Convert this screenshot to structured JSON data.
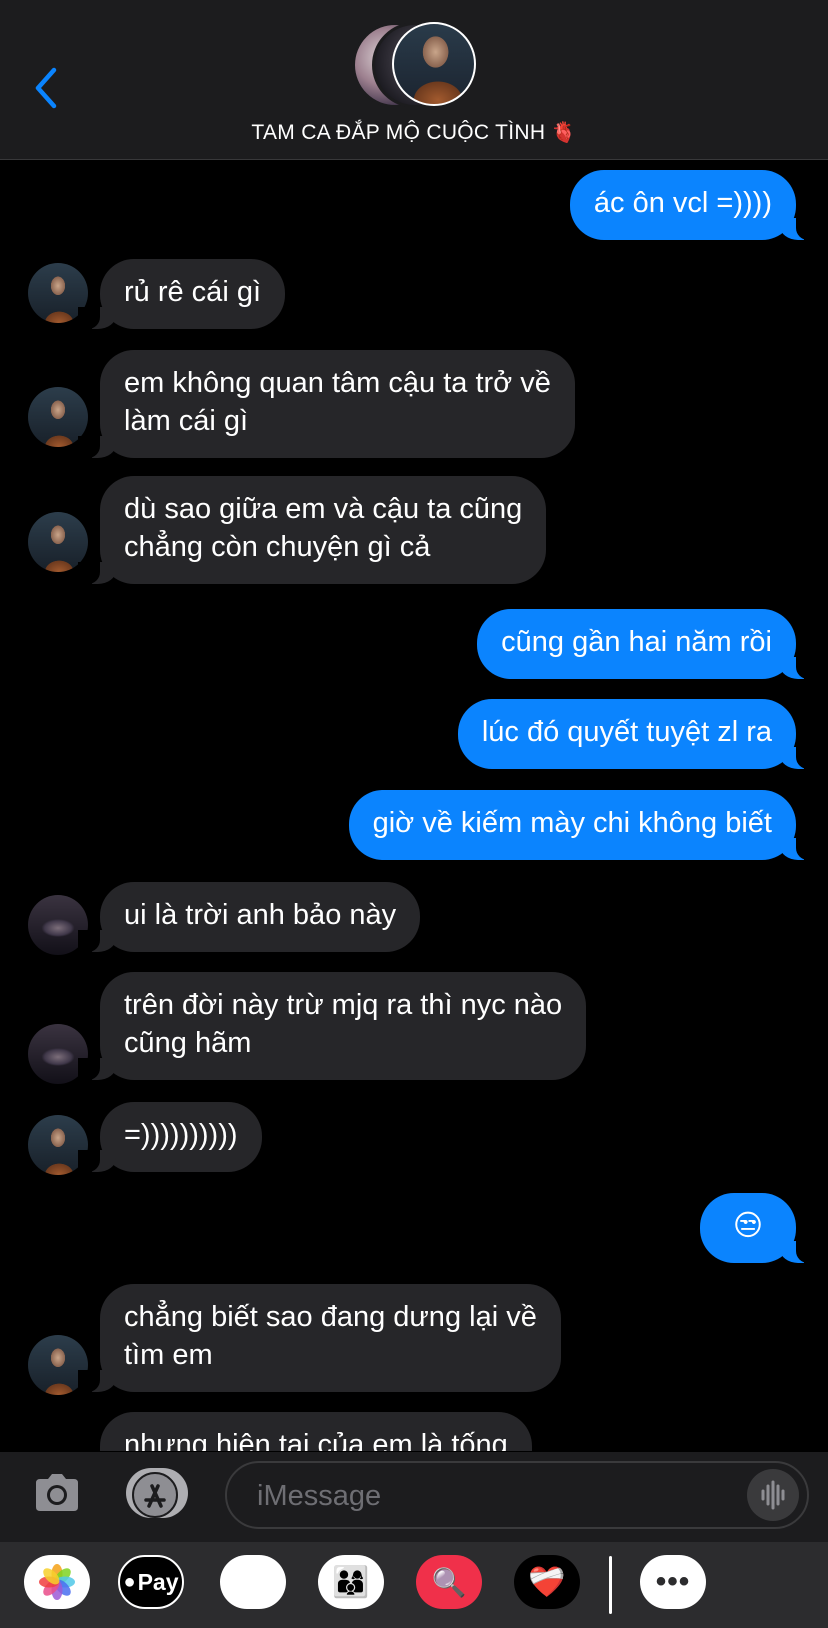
{
  "header": {
    "title": "TAM CA ĐẮP MỘ CUỘC TÌNH",
    "title_emoji": "🫀"
  },
  "messages": [
    {
      "dir": "out",
      "text": "ác ôn vcl =))))"
    },
    {
      "dir": "in",
      "text": "rủ rê cái gì",
      "avatar": "member-b"
    },
    {
      "dir": "in",
      "text": "em không quan tâm cậu ta trở về\nlàm cái gì",
      "avatar": "member-b"
    },
    {
      "dir": "in",
      "text": "dù sao giữa em và cậu ta cũng\nchẳng còn chuyện gì cả",
      "avatar": "member-b"
    },
    {
      "dir": "out",
      "text": "cũng gần hai năm rồi"
    },
    {
      "dir": "out",
      "text": "lúc đó quyết tuyệt zl ra"
    },
    {
      "dir": "out",
      "text": "giờ về kiếm mày chi không biết"
    },
    {
      "dir": "in",
      "text": "ui là trời anh bảo này",
      "avatar": "member-c"
    },
    {
      "dir": "in",
      "text": "trên đời này trừ mjq ra thì nyc nào\ncũng hãm",
      "avatar": "member-c"
    },
    {
      "dir": "in",
      "text": "=))))))))))",
      "avatar": "member-b"
    },
    {
      "dir": "out",
      "text": "😒"
    },
    {
      "dir": "in",
      "text": "chẳng biết sao đang dưng lại về\ntìm em",
      "avatar": "member-b"
    },
    {
      "dir": "in",
      "text": "nhưng hiện tại của em là tống",
      "avatar": "member-b"
    }
  ],
  "input": {
    "placeholder": "iMessage"
  },
  "apps": {
    "photos": "photos-icon",
    "apple_pay_label": "Pay",
    "monkey": "🐵",
    "memoji": "👨‍👩‍👦",
    "search": "🔍",
    "heart": "❤️‍🩹",
    "more": "•••"
  },
  "colors": {
    "outgoing": "#0b84fe",
    "incoming": "#262629",
    "header_bg": "#1c1c1e"
  }
}
